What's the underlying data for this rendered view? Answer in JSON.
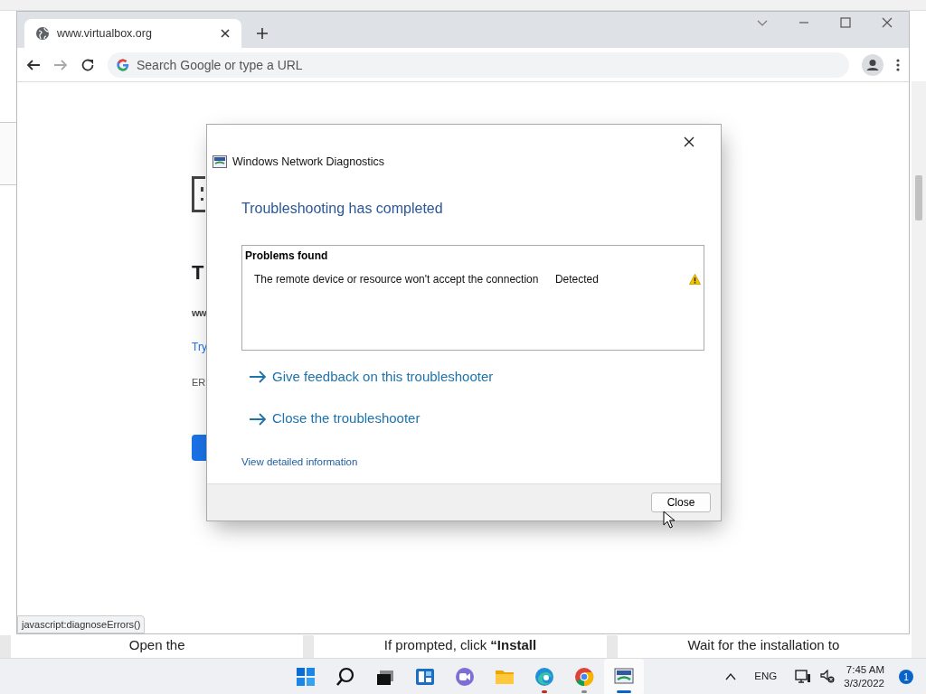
{
  "background_page": {
    "steps": [
      {
        "text": "Open the"
      },
      {
        "text": "If prompted, click **“Install**"
      },
      {
        "text": "Wait for the installation to"
      }
    ]
  },
  "browser": {
    "tabs": [
      {
        "title": "www.virtualbox.org",
        "selected": true
      }
    ],
    "address_bar": {
      "placeholder": "Search Google or type a URL"
    },
    "page": {
      "heading": "T",
      "host": "ww",
      "link": "Try",
      "error_code": "ER"
    },
    "status_link": "javascript:diagnoseErrors()"
  },
  "dialog": {
    "title": "Windows Network Diagnostics",
    "heading": "Troubleshooting has completed",
    "problems": {
      "title": "Problems found",
      "items": [
        {
          "description": "The remote device or resource won't accept the connection",
          "status": "Detected",
          "kind": "warning"
        }
      ]
    },
    "links": [
      "Give feedback on this troubleshooter",
      "Close the troubleshooter"
    ],
    "detail_link": "View detailed information",
    "buttons": [
      "Close"
    ]
  },
  "taskbar": {
    "apps": [
      {
        "kind": "start",
        "running": false,
        "active": false
      },
      {
        "kind": "search",
        "running": false,
        "active": false
      },
      {
        "kind": "taskview",
        "running": false,
        "active": false
      },
      {
        "kind": "widgets",
        "running": false,
        "active": false
      },
      {
        "kind": "chat",
        "running": false,
        "active": false
      },
      {
        "kind": "explorer",
        "running": false,
        "active": false
      },
      {
        "kind": "edge",
        "running": true,
        "active": false
      },
      {
        "kind": "chrome",
        "running": true,
        "active": false
      },
      {
        "kind": "diagnostics",
        "running": true,
        "active": true
      }
    ],
    "language": "ENG",
    "time": "7:45 AM",
    "date": "3/3/2022",
    "notifications": "1"
  }
}
